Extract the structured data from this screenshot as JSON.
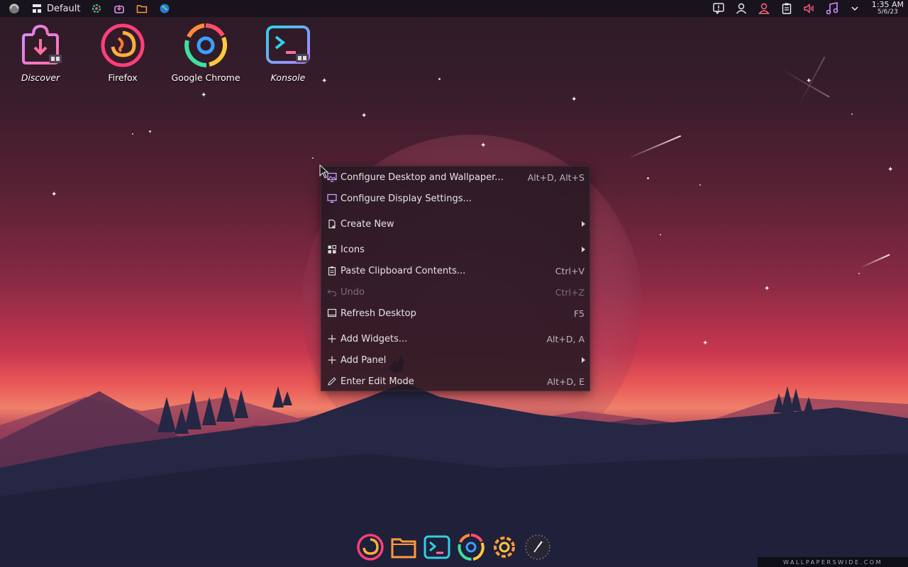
{
  "top_panel": {
    "activity_label": "Default",
    "left_icons": [
      "kde-logo-icon",
      "activity-icon",
      "settings-icon",
      "discover-icon",
      "folder-icon",
      "globe-icon"
    ],
    "right_icons": [
      "notifications-icon",
      "user-icon",
      "user-switch-icon",
      "clipboard-icon",
      "volume-icon",
      "music-icon",
      "chevron-down-icon"
    ],
    "clock_time": "1:35 AM",
    "clock_date": "5/6/23"
  },
  "desktop_icons": [
    {
      "label": "Discover",
      "icon": "discover-icon"
    },
    {
      "label": "Firefox",
      "icon": "firefox-icon"
    },
    {
      "label": "Google Chrome",
      "icon": "chrome-icon"
    },
    {
      "label": "Konsole",
      "icon": "konsole-icon"
    }
  ],
  "context_menu": {
    "items": [
      {
        "label": "Configure Desktop and Wallpaper...",
        "shortcut": "Alt+D, Alt+S",
        "icon": "wallpaper-icon"
      },
      {
        "label": "Configure Display Settings...",
        "shortcut": "",
        "icon": "display-icon"
      },
      {
        "label": "Create New",
        "shortcut": "",
        "icon": "new-file-icon"
      },
      {
        "label": "Icons",
        "shortcut": "",
        "icon": "icons-grid-icon"
      },
      {
        "label": "Paste Clipboard Contents...",
        "shortcut": "Ctrl+V",
        "icon": "paste-icon"
      },
      {
        "label": "Undo",
        "shortcut": "Ctrl+Z",
        "icon": "undo-icon"
      },
      {
        "label": "Refresh Desktop",
        "shortcut": "F5",
        "icon": "refresh-icon"
      },
      {
        "label": "Add Widgets...",
        "shortcut": "Alt+D, A",
        "icon": "plus-icon"
      },
      {
        "label": "Add Panel",
        "shortcut": "",
        "icon": "plus-icon"
      },
      {
        "label": "Enter Edit Mode",
        "shortcut": "Alt+D, E",
        "icon": "pencil-icon"
      }
    ]
  },
  "dock": [
    "firefox-icon",
    "folder-icon",
    "konsole-icon",
    "chrome-icon",
    "settings-icon",
    "clock-icon"
  ],
  "watermark": "WALLPAPERSWIDE.COM",
  "colors": {
    "accent_pink": "#ff4f8b",
    "accent_orange": "#ff9a3c",
    "accent_cyan": "#31d0e8",
    "accent_purple": "#b57cff"
  }
}
